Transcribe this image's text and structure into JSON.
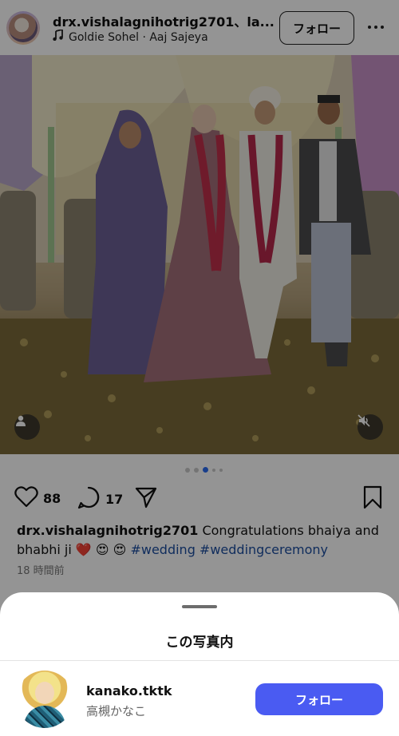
{
  "post": {
    "username": "drx.vishalagnihotrig2701、la...",
    "music_artist": "Goldie Sohel",
    "music_separator": "·",
    "music_title": "Aaj Sajeya",
    "follow_label": "フォロー",
    "likes": "88",
    "comments": "17",
    "caption_user": "drx.vishalagnihotrig2701",
    "caption_text": " Congratulations bhaiya and bhabhi ji ❤️ 😍 😍 ",
    "hashtags": "#wedding #weddingceremony",
    "timestamp": "18 時間前",
    "carousel_index": 3,
    "carousel_count": 5
  },
  "sheet": {
    "title": "この写真内",
    "person": {
      "username": "kanako.tktk",
      "display_name": "高槻かなこ",
      "follow_label": "フォロー"
    }
  },
  "colors": {
    "accent": "#4a5bf2",
    "hashtag": "#1d4ea0",
    "carousel_active": "#2a6cf0"
  },
  "icons": [
    "music-note-icon",
    "more-icon",
    "heart-icon",
    "comment-icon",
    "share-icon",
    "bookmark-icon",
    "user-tag-icon",
    "mute-icon"
  ]
}
